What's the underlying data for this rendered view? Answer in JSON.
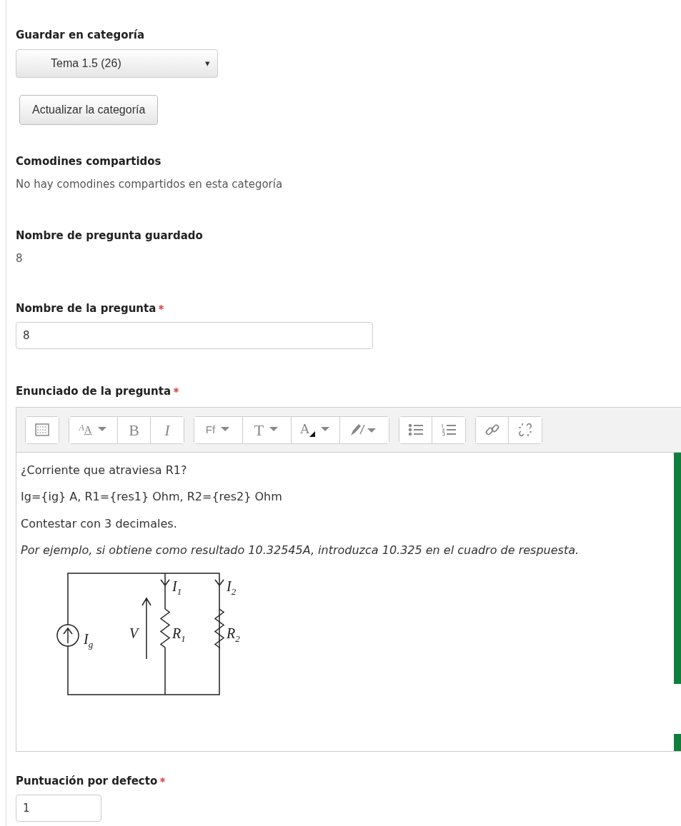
{
  "category": {
    "label": "Guardar en categoría",
    "value": "Tema 1.5 (26)",
    "caret": "▾",
    "update_button": "Actualizar la categoría"
  },
  "shared_wildcards": {
    "label": "Comodines compartidos",
    "text": "No hay comodines compartidos en esta categoría"
  },
  "saved_name": {
    "label": "Nombre de pregunta guardado",
    "value": "8"
  },
  "question_name": {
    "label": "Nombre de la pregunta",
    "required": true,
    "value": "8"
  },
  "question_text": {
    "label": "Enunciado de la pregunta",
    "required": true,
    "toolbar": [
      [
        {
          "kind": "toggle"
        }
      ],
      [
        {
          "kind": "style",
          "label": "AA"
        },
        {
          "kind": "bold",
          "label": "B"
        },
        {
          "kind": "italic",
          "label": "I"
        }
      ],
      [
        {
          "kind": "font",
          "label": "Ff"
        },
        {
          "kind": "size",
          "label": "T"
        },
        {
          "kind": "color",
          "label": "A"
        },
        {
          "kind": "highlight"
        }
      ],
      [
        {
          "kind": "bullets"
        },
        {
          "kind": "numbers"
        }
      ],
      [
        {
          "kind": "link"
        },
        {
          "kind": "unlink"
        }
      ]
    ],
    "paragraphs": [
      {
        "text": "¿Corriente que atraviesa R1?",
        "italic": false
      },
      {
        "text": "Ig={ig} A, R1={res1} Ohm, R2={res2} Ohm",
        "italic": false
      },
      {
        "text": "Contestar con 3 decimales.",
        "italic": false
      },
      {
        "text": "Por ejemplo, si obtiene como resultado 10.32545A, introduzca 10.325 en el cuadro de respuesta.",
        "italic": true
      }
    ],
    "circuit": {
      "labels": [
        {
          "main": "I",
          "sub": "1"
        },
        {
          "main": "I",
          "sub": "2"
        },
        {
          "main": "I",
          "sub": "g"
        },
        {
          "main": "V"
        },
        {
          "main": "R",
          "sub": "1"
        },
        {
          "main": "R",
          "sub": "2"
        }
      ]
    }
  },
  "default_mark": {
    "label": "Puntuación por defecto",
    "required": true,
    "value": "1"
  }
}
